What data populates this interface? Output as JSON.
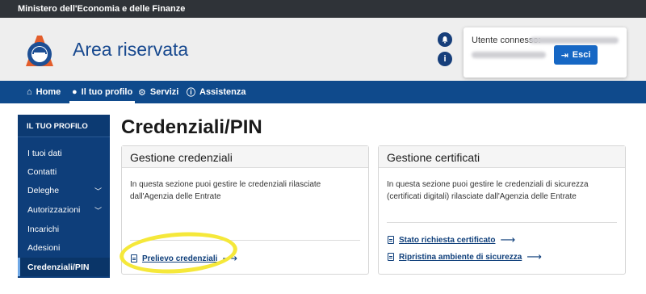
{
  "topbar": {
    "text": "Ministero dell'Economia e delle Finanze"
  },
  "header": {
    "title": "Area riservata",
    "user_label": "Utente connesso:",
    "logout_label": "Esci",
    "logout_icon": "logout-icon",
    "notifications_icon": "bell-icon",
    "info_icon": "info-icon"
  },
  "nav": {
    "items": [
      {
        "label": "Home",
        "icon": "home-icon"
      },
      {
        "label": "Il tuo profilo",
        "icon": "user-icon",
        "active": true
      },
      {
        "label": "Servizi",
        "icon": "services-icon"
      },
      {
        "label": "Assistenza",
        "icon": "info-icon"
      }
    ]
  },
  "sidebar": {
    "title": "IL TUO PROFILO",
    "items": [
      {
        "label": "I tuoi dati"
      },
      {
        "label": "Contatti"
      },
      {
        "label": "Deleghe",
        "expandable": true
      },
      {
        "label": "Autorizzazioni",
        "expandable": true
      },
      {
        "label": "Incarichi"
      },
      {
        "label": "Adesioni"
      },
      {
        "label": "Credenziali/PIN",
        "active": true
      }
    ]
  },
  "main": {
    "title": "Credenziali/PIN",
    "cards": [
      {
        "title": "Gestione credenziali",
        "text": "In questa sezione puoi gestire le credenziali rilasciate dall'Agenzia delle Entrate",
        "links": [
          "Prelievo credenziali"
        ]
      },
      {
        "title": "Gestione certificati",
        "text": "In questa sezione puoi gestire le credenziali di sicurezza (certificati digitali) rilasciate dall'Agenzia delle Entrate",
        "links": [
          "Stato richiesta certificato",
          "Ripristina ambiente di sicurezza"
        ]
      }
    ]
  },
  "colors": {
    "primary": "#0f4a8c",
    "sidebar": "#0e3e7a",
    "button": "#1667c4",
    "highlight": "#f5e83a",
    "topbar": "#2f3338"
  }
}
